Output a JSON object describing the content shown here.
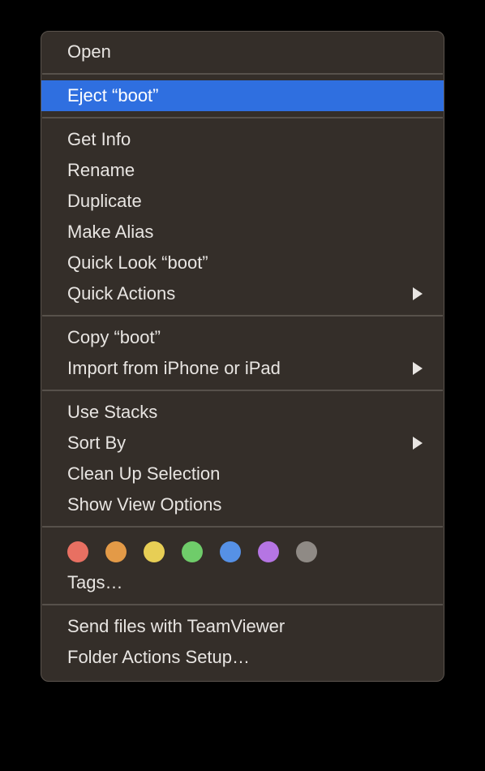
{
  "menu": {
    "sections": [
      {
        "items": [
          {
            "id": "open",
            "label": "Open",
            "submenu": false,
            "highlighted": false
          }
        ]
      },
      {
        "items": [
          {
            "id": "eject",
            "label": "Eject “boot”",
            "submenu": false,
            "highlighted": true
          }
        ]
      },
      {
        "items": [
          {
            "id": "getinfo",
            "label": "Get Info",
            "submenu": false,
            "highlighted": false
          },
          {
            "id": "rename",
            "label": "Rename",
            "submenu": false,
            "highlighted": false
          },
          {
            "id": "duplicate",
            "label": "Duplicate",
            "submenu": false,
            "highlighted": false
          },
          {
            "id": "makealias",
            "label": "Make Alias",
            "submenu": false,
            "highlighted": false
          },
          {
            "id": "quicklook",
            "label": "Quick Look “boot”",
            "submenu": false,
            "highlighted": false
          },
          {
            "id": "quickactions",
            "label": "Quick Actions",
            "submenu": true,
            "highlighted": false
          }
        ]
      },
      {
        "items": [
          {
            "id": "copy",
            "label": "Copy “boot”",
            "submenu": false,
            "highlighted": false
          },
          {
            "id": "import",
            "label": "Import from iPhone or iPad",
            "submenu": true,
            "highlighted": false
          }
        ]
      },
      {
        "items": [
          {
            "id": "usestacks",
            "label": "Use Stacks",
            "submenu": false,
            "highlighted": false
          },
          {
            "id": "sortby",
            "label": "Sort By",
            "submenu": true,
            "highlighted": false
          },
          {
            "id": "cleanup",
            "label": "Clean Up Selection",
            "submenu": false,
            "highlighted": false
          },
          {
            "id": "viewoptions",
            "label": "Show View Options",
            "submenu": false,
            "highlighted": false
          }
        ]
      },
      {
        "tags": true,
        "tag_colors": [
          "red",
          "orange",
          "yellow",
          "green",
          "blue",
          "purple",
          "gray"
        ],
        "tags_label": "Tags…"
      },
      {
        "items": [
          {
            "id": "teamviewer",
            "label": "Send files with TeamViewer",
            "submenu": false,
            "highlighted": false
          },
          {
            "id": "folderactions",
            "label": "Folder Actions Setup…",
            "submenu": false,
            "highlighted": false
          }
        ]
      }
    ]
  }
}
